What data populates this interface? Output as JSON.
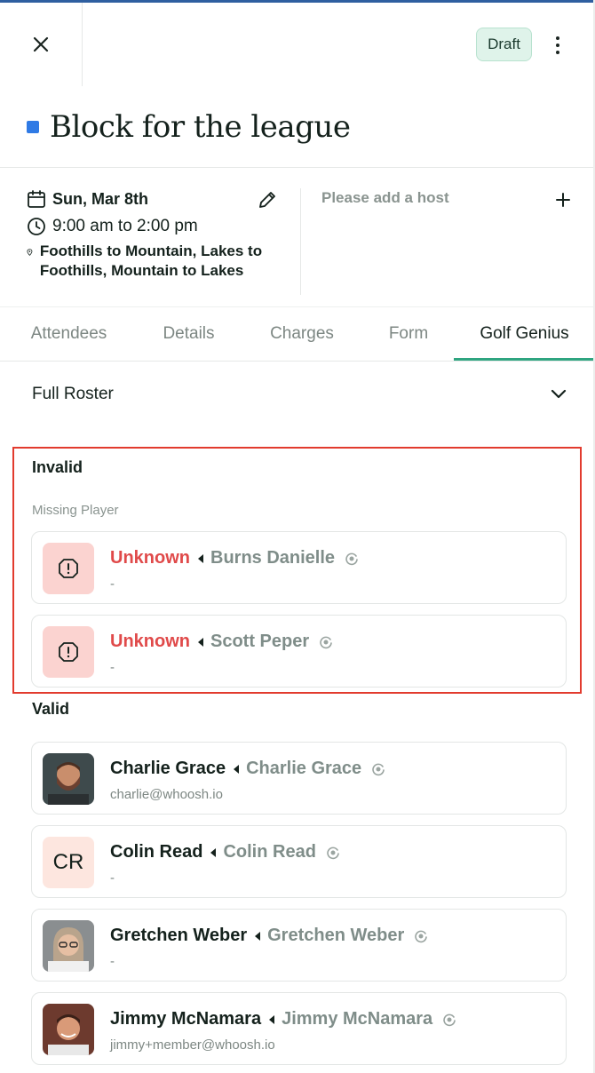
{
  "header": {
    "draft_label": "Draft",
    "icons": {
      "close": "close-icon",
      "more": "more-vertical-icon"
    }
  },
  "event": {
    "title": "Block for the league",
    "title_color": "#2f7ae5",
    "date": "Sun, Mar 8th",
    "time": "9:00 am to 2:00 pm",
    "location": "Foothills to Mountain, Lakes to Foothills, Mountain to Lakes",
    "host_placeholder": "Please add a host"
  },
  "tabs": [
    {
      "label": "Attendees",
      "active": false
    },
    {
      "label": "Details",
      "active": false
    },
    {
      "label": "Charges",
      "active": false
    },
    {
      "label": "Form",
      "active": false
    },
    {
      "label": "Golf Genius",
      "active": true
    }
  ],
  "roster": {
    "selected": "Full Roster"
  },
  "invalid": {
    "title": "Invalid",
    "subtitle": "Missing Player",
    "players": [
      {
        "status": "Unknown",
        "gg_name": "Burns Danielle",
        "detail": "-"
      },
      {
        "status": "Unknown",
        "gg_name": "Scott Peper",
        "detail": "-"
      }
    ]
  },
  "valid": {
    "title": "Valid",
    "players": [
      {
        "name": "Charlie Grace",
        "gg_name": "Charlie Grace",
        "detail": "charlie@whoosh.io",
        "avatar": "photo"
      },
      {
        "name": "Colin Read",
        "gg_name": "Colin Read",
        "detail": "-",
        "avatar": "initials",
        "initials": "CR"
      },
      {
        "name": "Gretchen Weber",
        "gg_name": "Gretchen Weber",
        "detail": "-",
        "avatar": "photo"
      },
      {
        "name": "Jimmy McNamara",
        "gg_name": "Jimmy McNamara",
        "detail": "jimmy+member@whoosh.io",
        "avatar": "photo"
      }
    ]
  },
  "colors": {
    "accent": "#2fa580",
    "error": "#e04a4a",
    "highlight_border": "#e23b2e",
    "draft_bg": "#dff3ea"
  }
}
